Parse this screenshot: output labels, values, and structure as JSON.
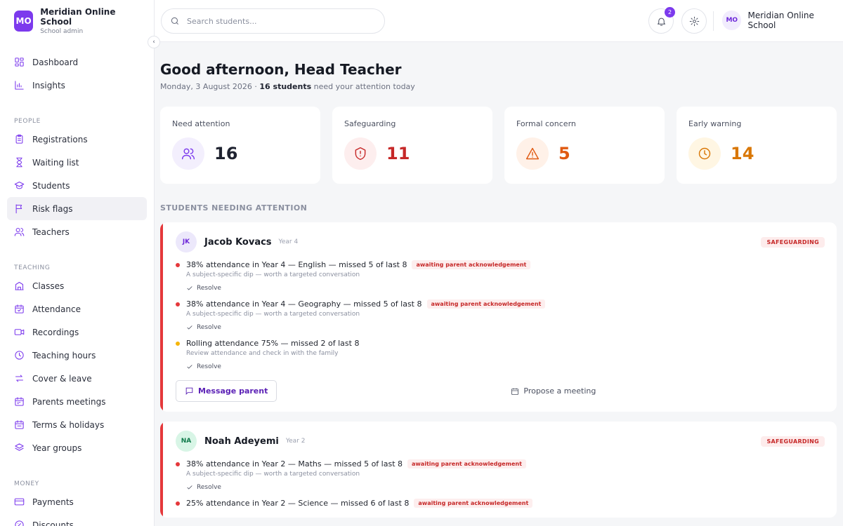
{
  "brand": {
    "initials": "MO",
    "name": "Meridian Online School",
    "role": "School admin"
  },
  "search": {
    "placeholder": "Search students..."
  },
  "header": {
    "notification_count": "2",
    "user_initials": "MO",
    "user_name": "Meridian Online School"
  },
  "sidebar": {
    "items": [
      {
        "label": "Dashboard",
        "icon": "dashboard-icon"
      },
      {
        "label": "Insights",
        "icon": "chart-icon"
      }
    ],
    "sections": [
      {
        "title": "PEOPLE",
        "items": [
          {
            "label": "Registrations",
            "icon": "clipboard-icon"
          },
          {
            "label": "Waiting list",
            "icon": "hourglass-icon"
          },
          {
            "label": "Students",
            "icon": "graduation-cap-icon"
          },
          {
            "label": "Risk flags",
            "icon": "flag-icon",
            "active": true
          },
          {
            "label": "Teachers",
            "icon": "users-icon"
          }
        ]
      },
      {
        "title": "TEACHING",
        "items": [
          {
            "label": "Classes",
            "icon": "building-icon"
          },
          {
            "label": "Attendance",
            "icon": "calendar-check-icon"
          },
          {
            "label": "Recordings",
            "icon": "video-icon"
          },
          {
            "label": "Teaching hours",
            "icon": "clock-icon"
          },
          {
            "label": "Cover & leave",
            "icon": "swap-icon"
          },
          {
            "label": "Parents meetings",
            "icon": "calendar-icon"
          },
          {
            "label": "Terms & holidays",
            "icon": "calendar-days-icon"
          },
          {
            "label": "Year groups",
            "icon": "layers-icon"
          }
        ]
      },
      {
        "title": "MONEY",
        "items": [
          {
            "label": "Payments",
            "icon": "credit-card-icon"
          },
          {
            "label": "Discounts",
            "icon": "percent-icon"
          }
        ]
      }
    ]
  },
  "main": {
    "greeting": "Good afternoon, Head Teacher",
    "date_text": "Monday, 3 August 2026 · ",
    "students_count_text": "16 students",
    "attention_suffix": " need your attention today",
    "stats": [
      {
        "label": "Need attention",
        "value": "16",
        "icon": "users-icon",
        "color": "#1f2330",
        "icon_color": "#7c3aed",
        "bg": "#f3effd"
      },
      {
        "label": "Safeguarding",
        "value": "11",
        "icon": "shield-alert-icon",
        "color": "#c62828",
        "icon_color": "#c62828",
        "bg": "#fdeeee"
      },
      {
        "label": "Formal concern",
        "value": "5",
        "icon": "warning-icon",
        "color": "#e05a12",
        "icon_color": "#e05a12",
        "bg": "#fff1e8"
      },
      {
        "label": "Early warning",
        "value": "14",
        "icon": "clock-icon",
        "color": "#d97706",
        "icon_color": "#d97706",
        "bg": "#fff6e3"
      }
    ],
    "section_title": "STUDENTS NEEDING ATTENTION",
    "students": [
      {
        "initials": "JK",
        "name": "Jacob Kovacs",
        "year": "Year 4",
        "tag": "SAFEGUARDING",
        "avatar_bg": "#ece8fb",
        "avatar_color": "#6d28d9",
        "flags": [
          {
            "title": "38% attendance in Year 4 — English — missed 5 of last 8",
            "status": "awaiting parent acknowledgement",
            "sub": "A subject-specific dip — worth a targeted conversation",
            "dot": "#e5383b",
            "resolve": "Resolve"
          },
          {
            "title": "38% attendance in Year 4 — Geography — missed 5 of last 8",
            "status": "awaiting parent acknowledgement",
            "sub": "A subject-specific dip — worth a targeted conversation",
            "dot": "#e5383b",
            "resolve": "Resolve"
          },
          {
            "title": "Rolling attendance 75% — missed 2 of last 8",
            "status": "",
            "sub": "Review attendance and check in with the family",
            "dot": "#f5b50a",
            "resolve": "Resolve"
          }
        ],
        "actions": {
          "message": "Message parent",
          "meeting": "Propose a meeting"
        }
      },
      {
        "initials": "NA",
        "name": "Noah Adeyemi",
        "year": "Year 2",
        "tag": "SAFEGUARDING",
        "avatar_bg": "#d8f5e6",
        "avatar_color": "#0f7a4a",
        "flags": [
          {
            "title": "38% attendance in Year 2 — Maths — missed 5 of last 8",
            "status": "awaiting parent acknowledgement",
            "sub": "A subject-specific dip — worth a targeted conversation",
            "dot": "#e5383b",
            "resolve": "Resolve"
          },
          {
            "title": "25% attendance in Year 2 — Science — missed 6 of last 8",
            "status": "awaiting parent acknowledgement",
            "sub": "",
            "dot": "#e5383b",
            "resolve": ""
          }
        ],
        "actions": {
          "message": "",
          "meeting": ""
        }
      }
    ]
  }
}
